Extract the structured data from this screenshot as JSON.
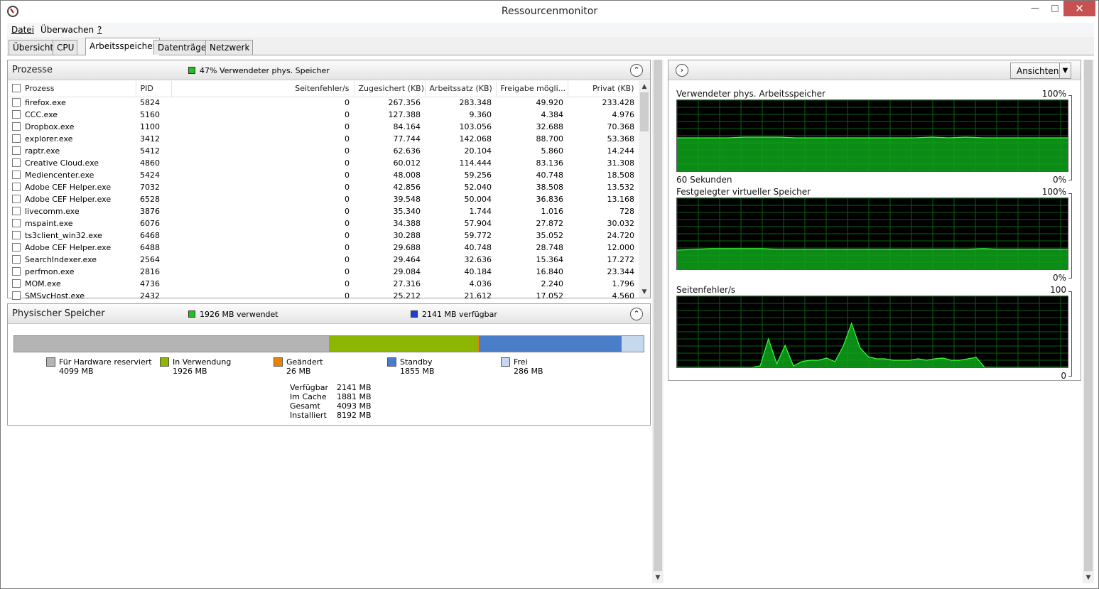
{
  "window": {
    "title": "Ressourcenmonitor",
    "min": "—",
    "max": "□",
    "close": "✕"
  },
  "menu": [
    "Datei",
    "Überwachen",
    "?"
  ],
  "tabs": [
    "Übersicht",
    "CPU",
    "Arbeitsspeicher",
    "Datenträger",
    "Netzwerk"
  ],
  "active_tab": "Arbeitsspeicher",
  "processes": {
    "title": "Prozesse",
    "status": "47% Verwendeter phys. Speicher",
    "status_color": "#1fc21f",
    "columns": [
      "Prozess",
      "PID",
      "Seitenfehler/s",
      "Zugesichert (KB)",
      "Arbeitssatz (KB)",
      "Freigabe mögli...",
      "Privat (KB)"
    ],
    "rows": [
      [
        "firefox.exe",
        "5824",
        "0",
        "267.356",
        "283.348",
        "49.920",
        "233.428"
      ],
      [
        "CCC.exe",
        "5160",
        "0",
        "127.388",
        "9.360",
        "4.384",
        "4.976"
      ],
      [
        "Dropbox.exe",
        "1100",
        "0",
        "84.164",
        "103.056",
        "32.688",
        "70.368"
      ],
      [
        "explorer.exe",
        "3412",
        "0",
        "77.744",
        "142.068",
        "88.700",
        "53.368"
      ],
      [
        "raptr.exe",
        "5412",
        "0",
        "62.636",
        "20.104",
        "5.860",
        "14.244"
      ],
      [
        "Creative Cloud.exe",
        "4860",
        "0",
        "60.012",
        "114.444",
        "83.136",
        "31.308"
      ],
      [
        "Mediencenter.exe",
        "5424",
        "0",
        "48.008",
        "59.256",
        "40.748",
        "18.508"
      ],
      [
        "Adobe CEF Helper.exe",
        "7032",
        "0",
        "42.856",
        "52.040",
        "38.508",
        "13.532"
      ],
      [
        "Adobe CEF Helper.exe",
        "6528",
        "0",
        "39.548",
        "50.004",
        "36.836",
        "13.168"
      ],
      [
        "livecomm.exe",
        "3876",
        "0",
        "35.340",
        "1.744",
        "1.016",
        "728"
      ],
      [
        "mspaint.exe",
        "6076",
        "0",
        "34.388",
        "57.904",
        "27.872",
        "30.032"
      ],
      [
        "ts3client_win32.exe",
        "6468",
        "0",
        "30.288",
        "59.772",
        "35.052",
        "24.720"
      ],
      [
        "Adobe CEF Helper.exe",
        "6488",
        "0",
        "29.688",
        "40.748",
        "28.748",
        "12.000"
      ],
      [
        "SearchIndexer.exe",
        "2564",
        "0",
        "29.464",
        "32.636",
        "15.364",
        "17.272"
      ],
      [
        "perfmon.exe",
        "2816",
        "0",
        "29.084",
        "40.184",
        "16.840",
        "23.344"
      ],
      [
        "MOM.exe",
        "4736",
        "0",
        "27.316",
        "4.036",
        "2.240",
        "1.796"
      ],
      [
        "SMSvcHost.exe",
        "2432",
        "0",
        "25.212",
        "21.612",
        "17.052",
        "4.560"
      ]
    ]
  },
  "physical": {
    "title": "Physischer Speicher",
    "used_label": "1926 MB verwendet",
    "used_color": "#1fc21f",
    "avail_label": "2141 MB verfügbar",
    "avail_color": "#1c3fd6",
    "bar": [
      {
        "name": "hardware",
        "mb": 4099,
        "color": "#b4b4b4"
      },
      {
        "name": "in-use",
        "mb": 1926,
        "color": "#8db600"
      },
      {
        "name": "modified",
        "mb": 26,
        "color": "#e8820c"
      },
      {
        "name": "standby",
        "mb": 1855,
        "color": "#4a7ec8"
      },
      {
        "name": "free",
        "mb": 286,
        "color": "#c6d8ee"
      }
    ],
    "legend": [
      {
        "label": "Für Hardware reserviert",
        "value": "4099 MB",
        "color": "#b4b4b4"
      },
      {
        "label": "In Verwendung",
        "value": "1926 MB",
        "color": "#8db600"
      },
      {
        "label": "Geändert",
        "value": "26 MB",
        "color": "#e8820c"
      },
      {
        "label": "Standby",
        "value": "1855 MB",
        "color": "#4a7ec8"
      },
      {
        "label": "Frei",
        "value": "286 MB",
        "color": "#c6d8ee"
      }
    ],
    "summary": [
      {
        "k": "Verfügbar",
        "v": "2141 MB"
      },
      {
        "k": "Im Cache",
        "v": "1881 MB"
      },
      {
        "k": "Gesamt",
        "v": "4093 MB"
      },
      {
        "k": "Installiert",
        "v": "8192 MB"
      }
    ]
  },
  "right_panel": {
    "views_label": "Ansichten",
    "graphs": [
      {
        "title": "Verwendeter phys. Arbeitsspeicher",
        "max": "100%",
        "min": "0%",
        "time": "60 Sekunden",
        "level": [
          0.47,
          0.47,
          0.47,
          0.47,
          0.48,
          0.48,
          0.48,
          0.47,
          0.47,
          0.47,
          0.47,
          0.47,
          0.47,
          0.47,
          0.47,
          0.48,
          0.47,
          0.48,
          0.47,
          0.47,
          0.47,
          0.47,
          0.47,
          0.47
        ]
      },
      {
        "title": "Festgelegter virtueller Speicher",
        "max": "100%",
        "min": "0%",
        "time": "",
        "level": [
          0.27,
          0.28,
          0.29,
          0.29,
          0.29,
          0.29,
          0.28,
          0.28,
          0.28,
          0.28,
          0.28,
          0.28,
          0.28,
          0.28,
          0.28,
          0.28,
          0.28,
          0.28,
          0.29,
          0.28,
          0.28,
          0.28,
          0.28,
          0.28
        ]
      },
      {
        "title": "Seitenfehler/s",
        "max": "100",
        "min": "0",
        "time": "",
        "spikes": [
          0,
          0,
          0,
          0,
          0,
          0,
          0,
          0,
          0,
          0,
          0.02,
          0.4,
          0.05,
          0.31,
          0.02,
          0.08,
          0.1,
          0.1,
          0.13,
          0.08,
          0.3,
          0.62,
          0.28,
          0.15,
          0.12,
          0.12,
          0.1,
          0.1,
          0.1,
          0.12,
          0.1,
          0.12,
          0.13,
          0.1,
          0.1,
          0.12,
          0.14,
          0.0,
          0,
          0,
          0,
          0,
          0,
          0,
          0,
          0,
          0,
          0
        ]
      }
    ]
  }
}
